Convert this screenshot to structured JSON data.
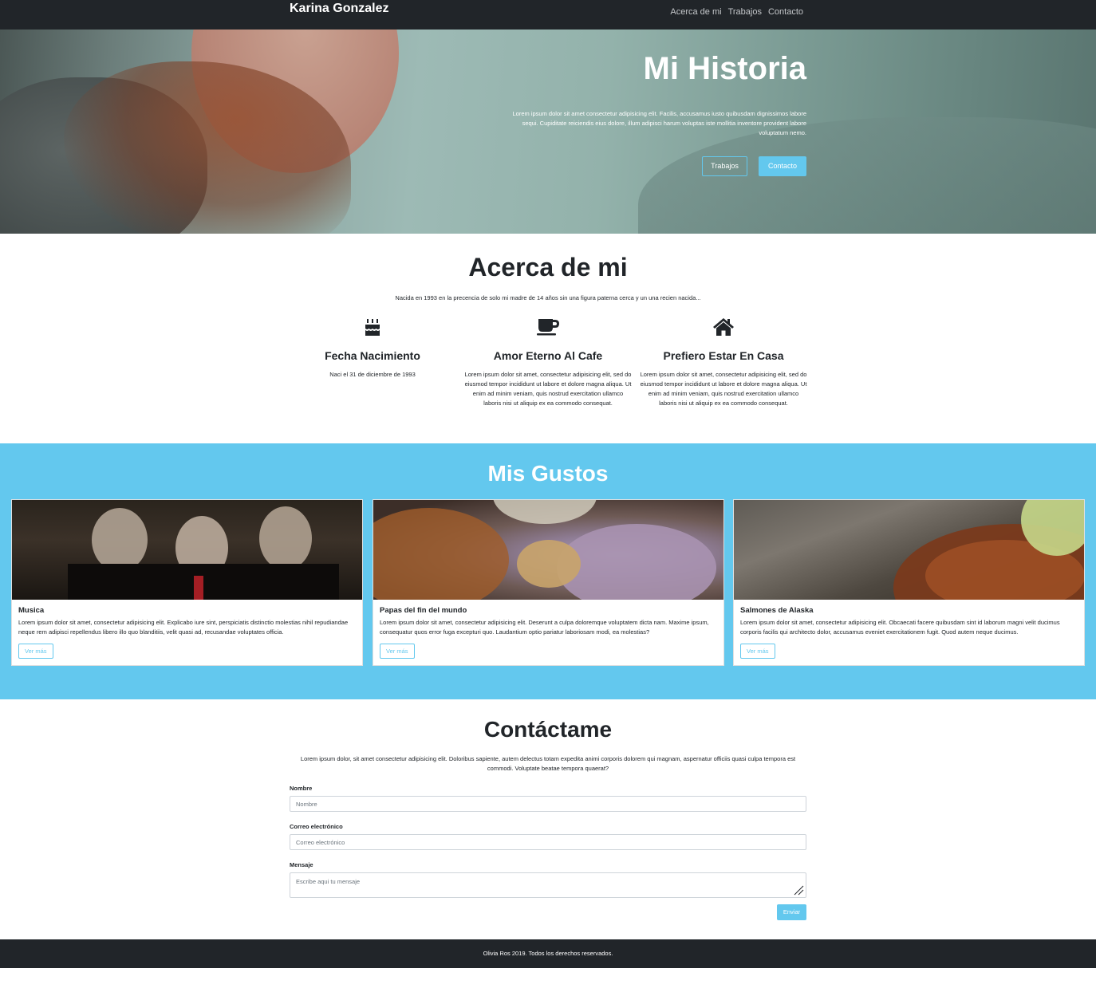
{
  "navbar": {
    "brand": "Karina Gonzalez",
    "links": [
      "Acerca de mi",
      "Trabajos",
      "Contacto"
    ]
  },
  "hero": {
    "title": "Mi Historia",
    "text": "Lorem ipsum dolor sit amet consectetur adipisicing elit. Facilis, accusamus iusto quibusdam dignissimos labore sequi. Cupiditate reiciendis eius dolore, illum adipisci harum voluptas iste mollitia inventore provident labore voluptatum nemo.",
    "button_works": "Trabajos",
    "button_contact": "Contacto"
  },
  "about": {
    "title": "Acerca de mi",
    "subtitle": "Nacida en 1993 en la precencia de solo mi madre de 14 años sin una figura paterna cerca y un una recien nacida...",
    "features": [
      {
        "icon": "birthday-cake-icon",
        "title": "Fecha Nacimiento",
        "text": "Naci el 31 de diciembre de 1993"
      },
      {
        "icon": "coffee-cup-icon",
        "title": "Amor Eterno Al Cafe",
        "text": "Lorem ipsum dolor sit amet, consectetur adipisicing elit, sed do eiusmod tempor incididunt ut labore et dolore magna aliqua. Ut enim ad minim veniam, quis nostrud exercitation ullamco laboris nisi ut aliquip ex ea commodo consequat."
      },
      {
        "icon": "home-icon",
        "title": "Prefiero Estar En Casa",
        "text": "Lorem ipsum dolor sit amet, consectetur adipisicing elit, sed do eiusmod tempor incididunt ut labore et dolore magna aliqua. Ut enim ad minim veniam, quis nostrud exercitation ullamco laboris nisi ut aliquip ex ea commodo consequat."
      }
    ]
  },
  "likes": {
    "title": "Mis Gustos",
    "cards": [
      {
        "title": "Musica",
        "text": "Lorem ipsum dolor sit amet, consectetur adipisicing elit. Explicabo iure sint, perspiciatis distinctio molestias nihil repudiandae neque rem adipisci repellendus libero illo quo blanditiis, velit quasi ad, recusandae voluptates officia.",
        "button": "Ver más"
      },
      {
        "title": "Papas del fin del mundo",
        "text": "Lorem ipsum dolor sit amet, consectetur adipisicing elit. Deserunt a culpa doloremque voluptatem dicta nam. Maxime ipsum, consequatur quos error fuga excepturi quo. Laudantium optio pariatur laboriosam modi, ea molestias?",
        "button": "Ver más"
      },
      {
        "title": "Salmones de Alaska",
        "text": "Lorem ipsum dolor sit amet, consectetur adipisicing elit. Obcaecati facere quibusdam sint id laborum magni velit ducimus corporis facilis qui architecto dolor, accusamus eveniet exercitationem fugit. Quod autem neque ducimus.",
        "button": "Ver más"
      }
    ]
  },
  "contact": {
    "title": "Contáctame",
    "text": "Lorem ipsum dolor, sit amet consectetur adipisicing elit. Doloribus sapiente, autem delectus totam expedita animi corporis dolorem qui magnam, aspernatur officiis quasi culpa tempora est commodi. Voluptate beatae tempora quaerat?",
    "name_label": "Nombre",
    "name_placeholder": "Nombre",
    "email_label": "Correo electrónico",
    "email_placeholder": "Correo electrónico",
    "message_label": "Mensaje",
    "message_placeholder": "Escribe aqui tu mensaje",
    "submit": "Enviar"
  },
  "footer": {
    "text": "Olivia Ros 2019. Todos los derechos reservados."
  },
  "colors": {
    "accent": "#63c8ee",
    "dark": "#212529"
  }
}
